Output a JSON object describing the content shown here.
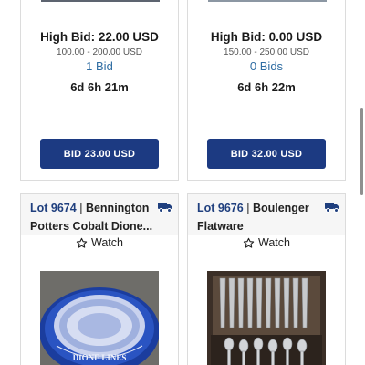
{
  "top_cards": [
    {
      "high_bid": "High Bid: 22.00 USD",
      "estimate": "100.00 - 200.00 USD",
      "bids": "1 Bid",
      "time_left": "6d 6h 21m",
      "bid_button": "BID 23.00 USD"
    },
    {
      "high_bid": "High Bid: 0.00 USD",
      "estimate": "150.00 - 250.00 USD",
      "bids": "0 Bids",
      "time_left": "6d 6h 22m",
      "bid_button": "BID 32.00 USD"
    }
  ],
  "bottom_cards": [
    {
      "lot_number": "Lot 9674",
      "separator": "|",
      "maker": "Bennington",
      "title": "Potters Cobalt Dione...",
      "watch_label": "Watch",
      "image_text": "DIONE LINES"
    },
    {
      "lot_number": "Lot 9676",
      "separator": "|",
      "maker": "Boulenger",
      "title": "Flatware",
      "watch_label": "Watch"
    }
  ],
  "icons": {
    "shipping": "truck-icon",
    "watch": "star-outline-icon"
  },
  "colors": {
    "bid_button": "#1c3a82",
    "lot_number": "#1f3f7e",
    "bids_link": "#2f6da3",
    "truck": "#1f3f7e"
  }
}
